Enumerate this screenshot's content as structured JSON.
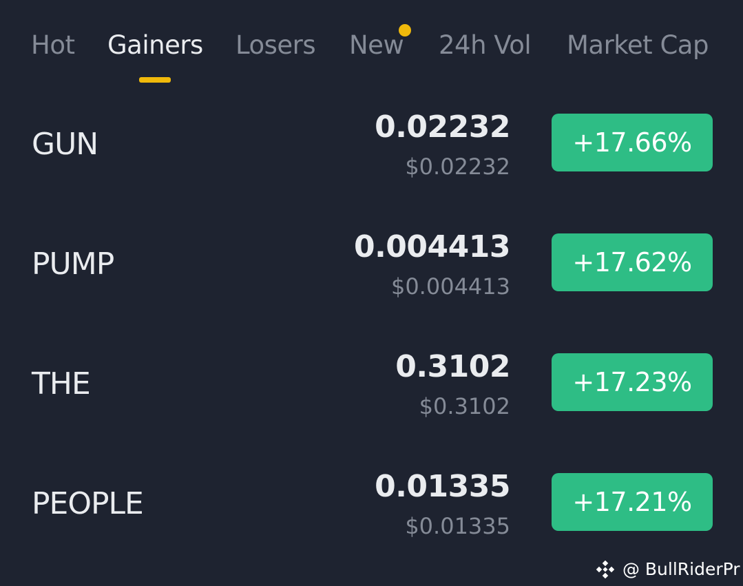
{
  "colors": {
    "background": "#1e2330",
    "active_tab_text": "#eaecef",
    "inactive_tab_text": "#858b97",
    "tab_indicator": "#f0b90b",
    "notification_dot": "#f0b90b",
    "positive_change": "#2ebd85",
    "secondary_text": "#858b97"
  },
  "tabs": [
    {
      "label": "Hot",
      "active": false
    },
    {
      "label": "Gainers",
      "active": true
    },
    {
      "label": "Losers",
      "active": false
    },
    {
      "label": "New",
      "active": false,
      "has_dot": true
    },
    {
      "label": "24h Vol",
      "active": false
    },
    {
      "label": "Market Cap",
      "active": false
    }
  ],
  "rows": [
    {
      "symbol": "GUN",
      "price": "0.02232",
      "usd": "$0.02232",
      "change": "+17.66%"
    },
    {
      "symbol": "PUMP",
      "price": "0.004413",
      "usd": "$0.004413",
      "change": "+17.62%"
    },
    {
      "symbol": "THE",
      "price": "0.3102",
      "usd": "$0.3102",
      "change": "+17.23%"
    },
    {
      "symbol": "PEOPLE",
      "price": "0.01335",
      "usd": "$0.01335",
      "change": "+17.21%"
    }
  ],
  "watermark": {
    "icon": "binance-logo-icon",
    "text": "@ BullRiderPr"
  }
}
